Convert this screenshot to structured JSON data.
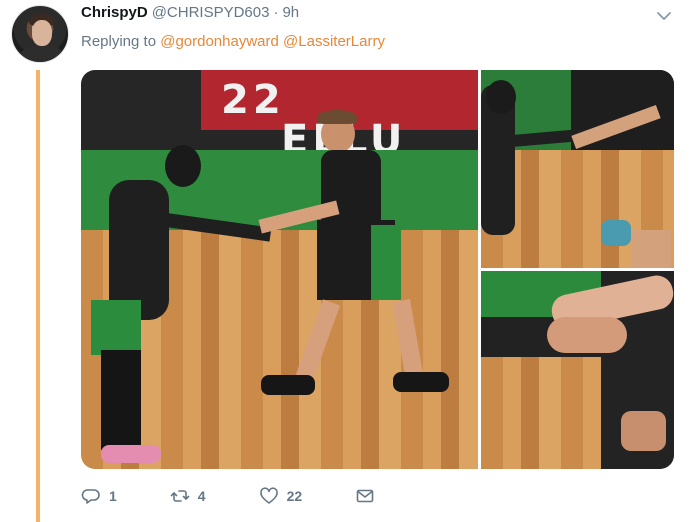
{
  "tweet": {
    "author_name": "ChrispyD",
    "author_handle": "@CHRISPYD603",
    "separator": "·",
    "time": "9h",
    "reply_prefix": "Replying to",
    "mentions": [
      "@gordonhayward",
      "@LassiterLarry"
    ],
    "media": {
      "banner_main": "22",
      "banner_main_right": "ELLU"
    },
    "actions": {
      "replies": "1",
      "retweets": "4",
      "likes": "22"
    }
  },
  "colors": {
    "thread_line": "#f5b26b",
    "mention": "#e6883a",
    "secondary_text": "#657786"
  },
  "icons": [
    "chevron-down-icon",
    "reply-icon",
    "retweet-icon",
    "like-icon",
    "message-icon"
  ]
}
